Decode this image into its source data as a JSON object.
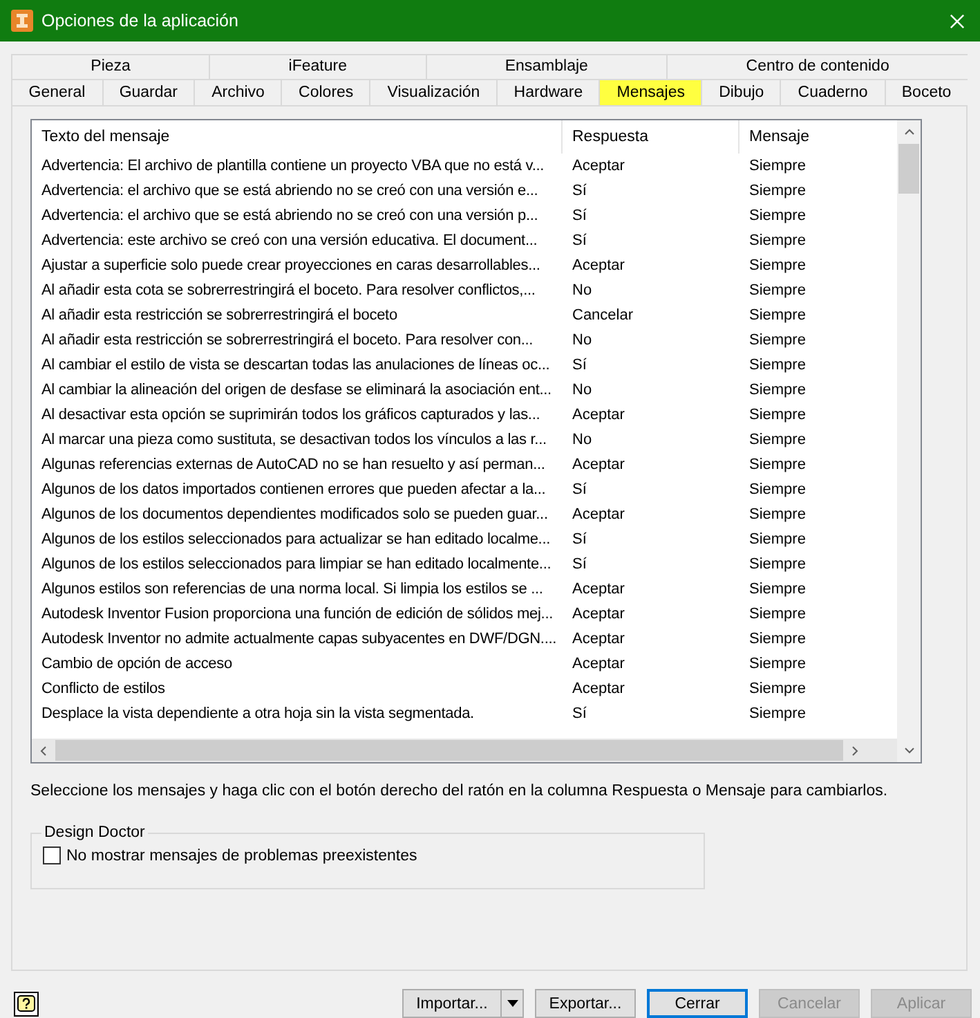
{
  "window": {
    "title": "Opciones de la aplicación"
  },
  "tab_rows": [
    {
      "tabs": [
        {
          "label": "Pieza",
          "selected": false
        },
        {
          "label": "iFeature",
          "selected": false
        },
        {
          "label": "Ensamblaje",
          "selected": false
        },
        {
          "label": "Centro de contenido",
          "selected": false
        }
      ]
    },
    {
      "tabs": [
        {
          "label": "General",
          "selected": false
        },
        {
          "label": "Guardar",
          "selected": false
        },
        {
          "label": "Archivo",
          "selected": false
        },
        {
          "label": "Colores",
          "selected": false
        },
        {
          "label": "Visualización",
          "selected": false
        },
        {
          "label": "Hardware",
          "selected": false
        },
        {
          "label": "Mensajes",
          "selected": true
        },
        {
          "label": "Dibujo",
          "selected": false
        },
        {
          "label": "Cuaderno",
          "selected": false
        },
        {
          "label": "Boceto",
          "selected": false
        }
      ]
    }
  ],
  "table": {
    "columns": [
      "Texto del mensaje",
      "Respuesta",
      "Mensaje"
    ],
    "rows": [
      [
        "Advertencia: El archivo de plantilla contiene un proyecto VBA que no está v...",
        "Aceptar",
        "Siempre"
      ],
      [
        "Advertencia: el archivo que se está abriendo no se creó con una versión e...",
        "Sí",
        "Siempre"
      ],
      [
        "Advertencia: el archivo que se está abriendo no se creó con una versión p...",
        "Sí",
        "Siempre"
      ],
      [
        "Advertencia: este archivo se creó con una versión educativa.  El document...",
        "Sí",
        "Siempre"
      ],
      [
        "Ajustar a superficie solo puede crear proyecciones en caras desarrollables...",
        "Aceptar",
        "Siempre"
      ],
      [
        "Al añadir esta cota se sobrerrestringirá el boceto.   Para resolver conflictos,...",
        "No",
        "Siempre"
      ],
      [
        "Al añadir esta restricción se sobrerrestringirá el boceto",
        "Cancelar",
        "Siempre"
      ],
      [
        "Al añadir esta restricción se sobrerrestringirá el boceto.   Para resolver con...",
        "No",
        "Siempre"
      ],
      [
        "Al cambiar el estilo de vista se descartan todas las anulaciones de líneas oc...",
        "Sí",
        "Siempre"
      ],
      [
        "Al cambiar la alineación del origen de desfase se eliminará la asociación ent...",
        "No",
        "Siempre"
      ],
      [
        "Al desactivar esta opción se suprimirán todos los gráficos capturados y las...",
        "Aceptar",
        "Siempre"
      ],
      [
        "Al marcar una pieza como sustituta, se desactivan todos los vínculos a las r...",
        "No",
        "Siempre"
      ],
      [
        "Algunas referencias externas de AutoCAD no se han resuelto y así perman...",
        "Aceptar",
        "Siempre"
      ],
      [
        "Algunos de los datos importados contienen errores que pueden afectar a la...",
        "Sí",
        "Siempre"
      ],
      [
        "Algunos de los documentos dependientes modificados solo se pueden guar...",
        "Aceptar",
        "Siempre"
      ],
      [
        "Algunos de los estilos seleccionados para actualizar se han editado localme...",
        "Sí",
        "Siempre"
      ],
      [
        "Algunos de los estilos seleccionados para limpiar se han editado localmente...",
        "Sí",
        "Siempre"
      ],
      [
        "Algunos estilos son referencias de una norma local. Si limpia los estilos se ...",
        "Aceptar",
        "Siempre"
      ],
      [
        "Autodesk Inventor Fusion proporciona una función de edición de sólidos mej...",
        "Aceptar",
        "Siempre"
      ],
      [
        "Autodesk Inventor no admite actualmente capas subyacentes en DWF/DGN....",
        "Aceptar",
        "Siempre"
      ],
      [
        "Cambio de opción de acceso",
        "Aceptar",
        "Siempre"
      ],
      [
        "Conflicto de estilos",
        "Aceptar",
        "Siempre"
      ],
      [
        "Desplace la vista dependiente a otra hoja sin la vista segmentada.",
        "Sí",
        "Siempre"
      ]
    ]
  },
  "hint": "Seleccione los mensajes y haga clic con el botón derecho del ratón en la columna Respuesta o Mensaje para cambiarlos.",
  "design_doctor": {
    "title": "Design Doctor",
    "checkbox": {
      "label": "No mostrar mensajes de problemas preexistentes",
      "checked": false
    }
  },
  "buttons": [
    {
      "label": "Importar...",
      "kind": "split",
      "disabled": false,
      "default": false
    },
    {
      "label": "Exportar...",
      "kind": "plain",
      "disabled": false,
      "default": false
    },
    {
      "label": "Cerrar",
      "kind": "plain",
      "disabled": false,
      "default": true
    },
    {
      "label": "Cancelar",
      "kind": "plain",
      "disabled": true,
      "default": false
    },
    {
      "label": "Aplicar",
      "kind": "plain",
      "disabled": true,
      "default": false
    }
  ]
}
